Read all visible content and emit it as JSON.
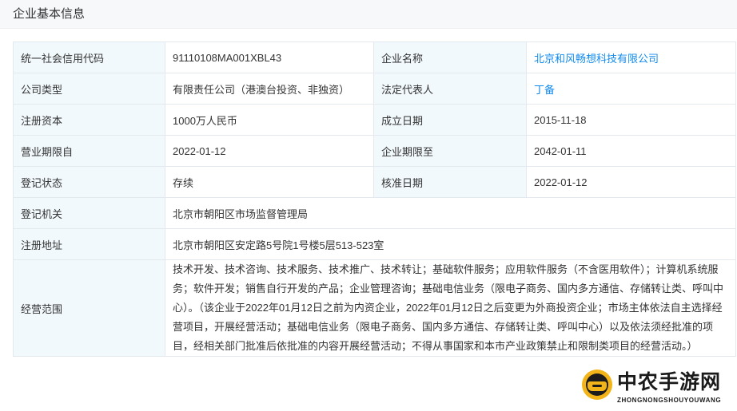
{
  "section_title": "企业基本信息",
  "rows": {
    "r1": {
      "l1": "统一社会信用代码",
      "v1": "91110108MA001XBL43",
      "l2": "企业名称",
      "v2": "北京和风畅想科技有限公司"
    },
    "r2": {
      "l1": "公司类型",
      "v1": "有限责任公司（港澳台投资、非独资）",
      "l2": "法定代表人",
      "v2": "丁备"
    },
    "r3": {
      "l1": "注册资本",
      "v1": "1000万人民币",
      "l2": "成立日期",
      "v2": "2015-11-18"
    },
    "r4": {
      "l1": "营业期限自",
      "v1": "2022-01-12",
      "l2": "企业期限至",
      "v2": "2042-01-11"
    },
    "r5": {
      "l1": "登记状态",
      "v1": "存续",
      "l2": "核准日期",
      "v2": "2022-01-12"
    },
    "r6": {
      "l1": "登记机关",
      "v1": "北京市朝阳区市场监督管理局"
    },
    "r7": {
      "l1": "注册地址",
      "v1": "北京市朝阳区安定路5号院1号楼5层513-523室"
    },
    "r8": {
      "l1": "经营范围",
      "v1": "技术开发、技术咨询、技术服务、技术推广、技术转让；基础软件服务；应用软件服务（不含医用软件）；计算机系统服务；软件开发；销售自行开发的产品；企业管理咨询；基础电信业务（限电子商务、国内多方通信、存储转让类、呼叫中心）。（该企业于2022年01月12日之前为内资企业，2022年01月12日之后变更为外商投资企业；市场主体依法自主选择经营项目，开展经营活动；基础电信业务（限电子商务、国内多方通信、存储转让类、呼叫中心）以及依法须经批准的项目，经相关部门批准后依批准的内容开展经营活动；不得从事国家和本市产业政策禁止和限制类项目的经营活动。）"
    }
  },
  "watermark": {
    "title": "中农手游网",
    "subtitle": "ZHONGNONGSHOUYOUWANG",
    "logo_icon": "gamepad-logo-icon"
  },
  "colors": {
    "link": "#128bed",
    "label_bg": "#f2f9fc",
    "border": "#e4e9f0",
    "header_bg": "#f7f8fa"
  }
}
